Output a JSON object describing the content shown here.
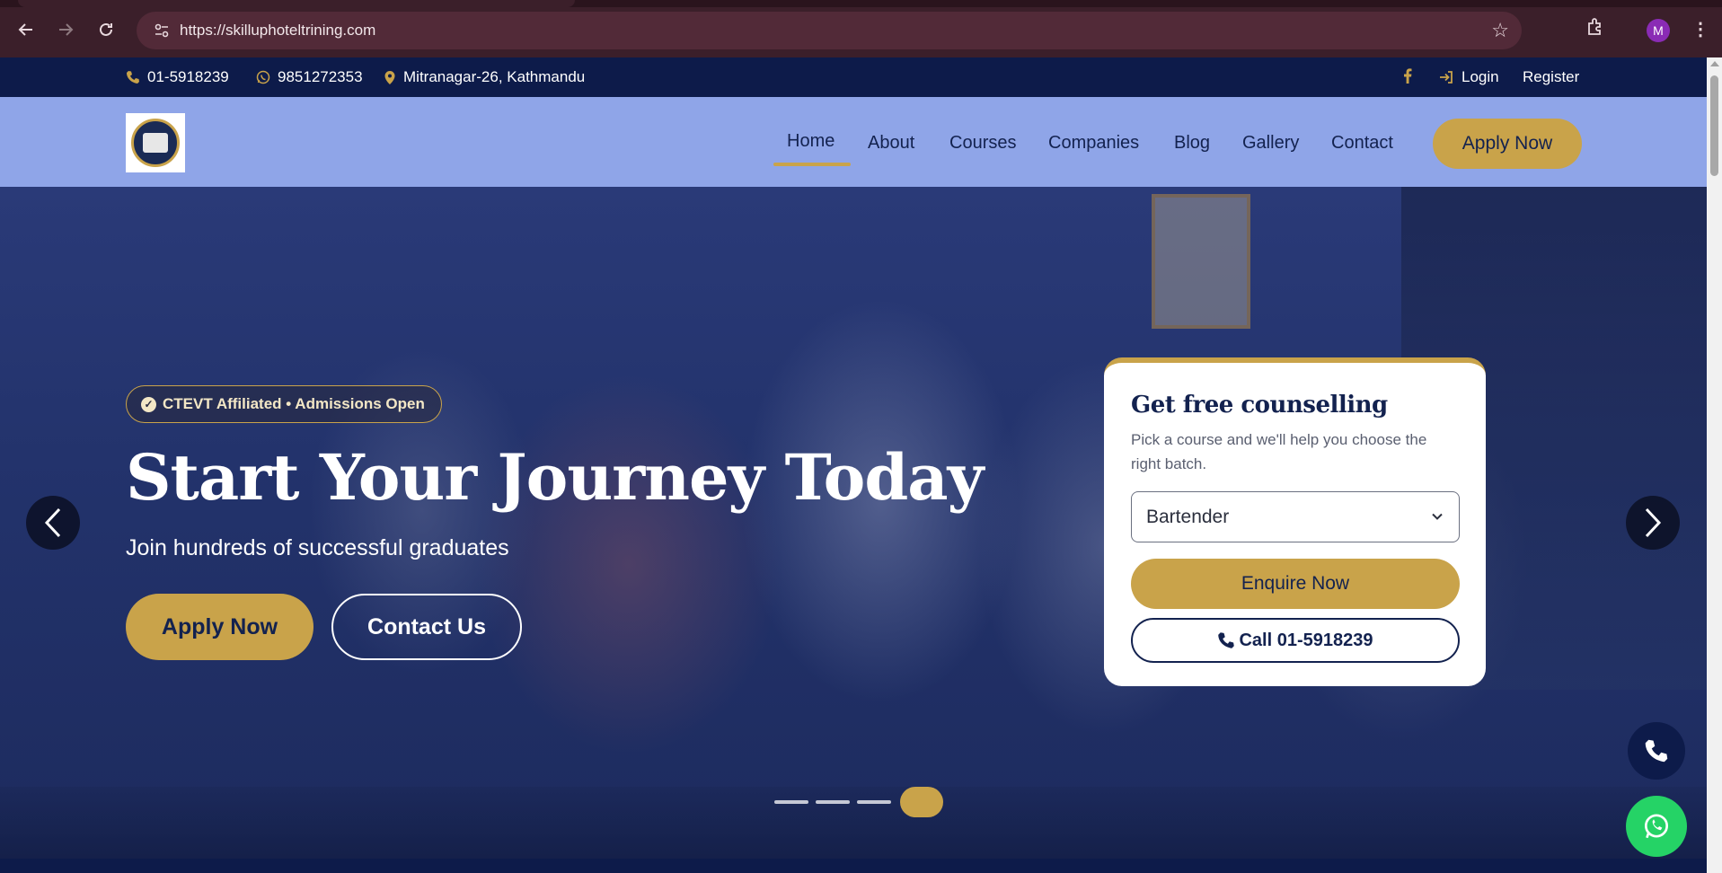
{
  "browser": {
    "url": "https://skilluphoteltrining.com",
    "profile_initial": "M"
  },
  "topbar": {
    "phone": "01-5918239",
    "whatsapp": "9851272353",
    "address": "Mitranagar-26, Kathmandu",
    "login": "Login",
    "register": "Register"
  },
  "nav": {
    "items": [
      "Home",
      "About",
      "Courses",
      "Companies",
      "Blog",
      "Gallery",
      "Contact"
    ],
    "active": "Home",
    "apply": "Apply Now"
  },
  "hero": {
    "badge": "CTEVT Affiliated • Admissions Open",
    "title": "Start Your Journey Today",
    "subtitle": "Join hundreds of successful graduates",
    "apply_button": "Apply Now",
    "contact_button": "Contact Us",
    "slides_total": 4,
    "active_slide": 4
  },
  "counselling": {
    "title": "Get free counselling",
    "description": "Pick a course and we'll help you choose the right batch.",
    "selected_course": "Bartender",
    "enquire_button": "Enquire Now",
    "call_button": "Call 01-5918239"
  },
  "colors": {
    "navy": "#0d1b4a",
    "gold": "#c9a34a",
    "nav_bg": "#8fa5e8",
    "whatsapp_green": "#25d366"
  }
}
